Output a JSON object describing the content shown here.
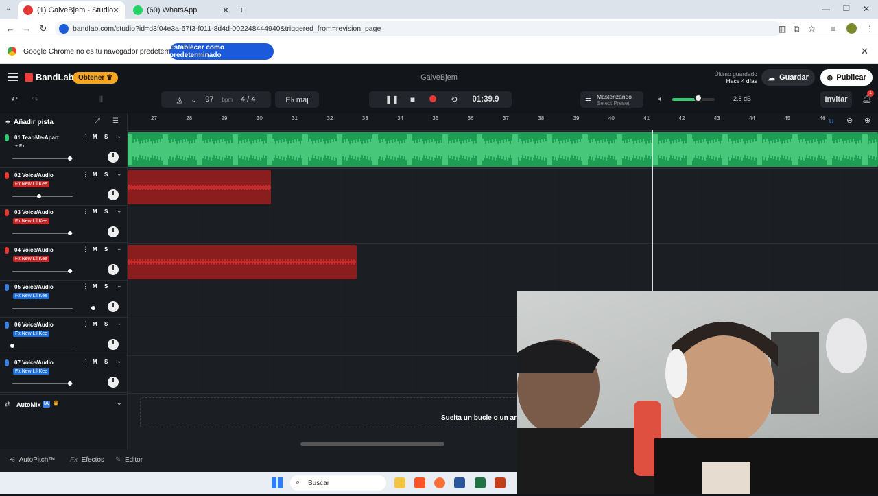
{
  "browser": {
    "tabs": [
      {
        "title": "(1) GalveBjem - Studio",
        "active": true
      },
      {
        "title": "(69) WhatsApp",
        "active": false
      }
    ],
    "url": "bandlab.com/studio?id=d3f04e3a-57f3-f011-8d4d-002248444940&triggered_from=revision_page",
    "infobar": {
      "message": "Google Chrome no es tu navegador predeterminado",
      "button": "Establecer como predeterminado"
    }
  },
  "app": {
    "logo": "BandLab",
    "get_button": "Obtener",
    "project_title": "GalveBjem",
    "saved_label": "Último guardado",
    "saved_time": "Hace 4 días",
    "save_button": "Guardar",
    "publish_button": "Publicar"
  },
  "toolbar": {
    "tempo": "97",
    "tempo_unit": "bpm",
    "time_signature": "4 / 4",
    "key": "E♭ maj",
    "time": "01:39.9",
    "mastering_label": "Masterizando",
    "mastering_preset": "Select Preset",
    "volume_db": "-2.8 dB",
    "volume_level": 0.62,
    "invite_button": "Invitar",
    "notifications": "1"
  },
  "track_panel": {
    "add_track": "Añadir pista",
    "tracks": [
      {
        "name": "01  Tear-Me-Apart",
        "fx": "+ Fx",
        "fx_style": "plain",
        "mic_color": "#2ecc71",
        "volume": 0.98
      },
      {
        "name": "02  Voice/Audio",
        "fx": "Fx  New Lil Kee",
        "fx_style": "red",
        "mic_color": "#e53935",
        "volume": 0.46
      },
      {
        "name": "03  Voice/Audio",
        "fx": "Fx  New Lil Kee",
        "fx_style": "red",
        "mic_color": "#e53935",
        "volume": 0.98
      },
      {
        "name": "04  Voice/Audio",
        "fx": "Fx  New Lil Kee",
        "fx_style": "red",
        "mic_color": "#e53935",
        "volume": 0.98
      },
      {
        "name": "05  Voice/Audio",
        "fx": "Fx  New Lil Kee",
        "fx_style": "blue",
        "mic_color": "#3d7fe0",
        "volume": 1.38
      },
      {
        "name": "06  Voice/Audio",
        "fx": "Fx  New Lil Kee",
        "fx_style": "blue",
        "mic_color": "#3d7fe0",
        "volume": 0.0
      },
      {
        "name": "07  Voice/Audio",
        "fx": "Fx  New Lil Kee",
        "fx_style": "blue",
        "mic_color": "#3d7fe0",
        "volume": 0.98
      }
    ],
    "mute_label": "M",
    "solo_label": "S",
    "automix": "AutoMix",
    "automix_badge": "IA"
  },
  "timeline": {
    "bars": [
      "27",
      "28",
      "29",
      "30",
      "31",
      "32",
      "33",
      "34",
      "35",
      "36",
      "37",
      "38",
      "39",
      "40",
      "41",
      "42",
      "43",
      "44",
      "45",
      "46"
    ],
    "drop_text": "Suelta un bucle o un archiv"
  },
  "bottom": {
    "autopitch": "AutoPitch™",
    "effects": "Efectos",
    "editor": "Editor"
  },
  "taskbar": {
    "search": "Buscar"
  },
  "colors": {
    "green_clip": "#1e9e55",
    "red_clip": "#8a1d1d",
    "accent": "#1a5adb",
    "get_button": "#f5a623"
  }
}
